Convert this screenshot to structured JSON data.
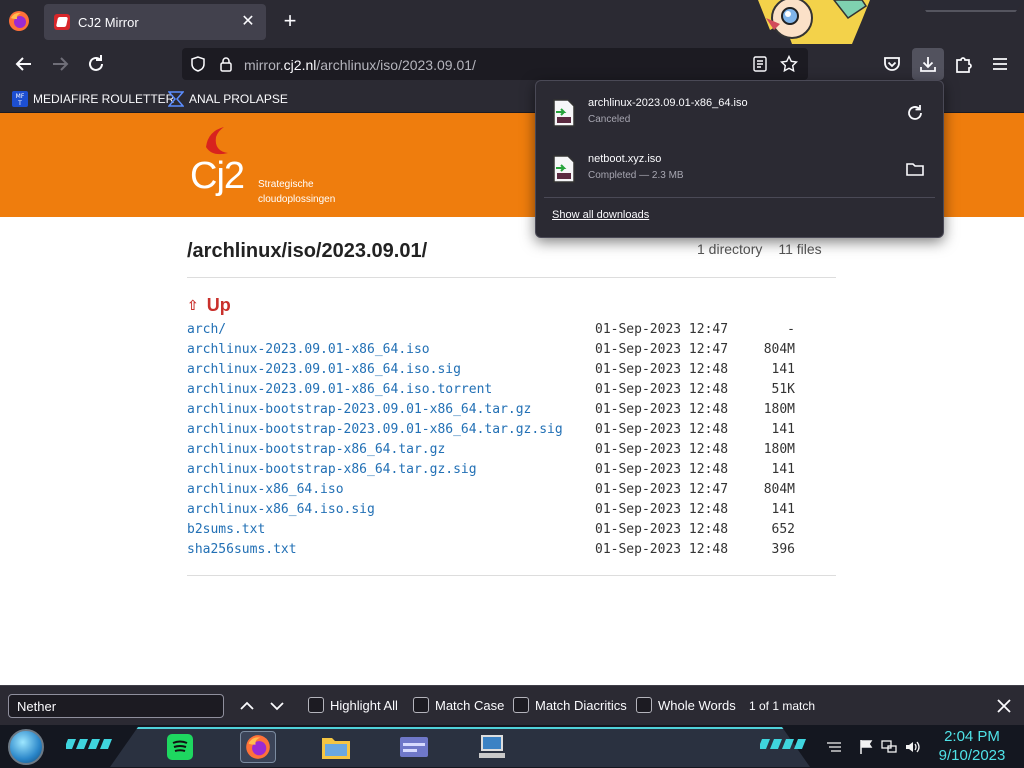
{
  "browser": {
    "tab": {
      "title": "CJ2 Mirror"
    },
    "url": {
      "prefix": "mirror.",
      "domain": "cj2.nl",
      "path": "/archlinux/iso/2023.09.01/"
    },
    "bookmarks": [
      {
        "label": "MEDIAFIRE ROULETTER",
        "icon": "mediafire-icon",
        "icon_text": "MF T"
      },
      {
        "label": "ANAL PROLAPSE",
        "icon": "bookmark-icon"
      }
    ]
  },
  "page": {
    "logo": {
      "text": "Cj2",
      "tagline_line1": "Strategische",
      "tagline_line2": "cloudoplossingen"
    },
    "title": "/archlinux/iso/2023.09.01/",
    "dir_count": "1 directory",
    "file_count": "11 files",
    "up_label": "Up",
    "files": [
      {
        "name": "arch/",
        "date": "01-Sep-2023 12:47",
        "size": "-"
      },
      {
        "name": "archlinux-2023.09.01-x86_64.iso",
        "date": "01-Sep-2023 12:47",
        "size": "804M"
      },
      {
        "name": "archlinux-2023.09.01-x86_64.iso.sig",
        "date": "01-Sep-2023 12:48",
        "size": "141"
      },
      {
        "name": "archlinux-2023.09.01-x86_64.iso.torrent",
        "date": "01-Sep-2023 12:48",
        "size": "51K"
      },
      {
        "name": "archlinux-bootstrap-2023.09.01-x86_64.tar.gz",
        "date": "01-Sep-2023 12:48",
        "size": "180M"
      },
      {
        "name": "archlinux-bootstrap-2023.09.01-x86_64.tar.gz.sig",
        "date": "01-Sep-2023 12:48",
        "size": "141"
      },
      {
        "name": "archlinux-bootstrap-x86_64.tar.gz",
        "date": "01-Sep-2023 12:48",
        "size": "180M"
      },
      {
        "name": "archlinux-bootstrap-x86_64.tar.gz.sig",
        "date": "01-Sep-2023 12:48",
        "size": "141"
      },
      {
        "name": "archlinux-x86_64.iso",
        "date": "01-Sep-2023 12:47",
        "size": "804M"
      },
      {
        "name": "archlinux-x86_64.iso.sig",
        "date": "01-Sep-2023 12:48",
        "size": "141"
      },
      {
        "name": "b2sums.txt",
        "date": "01-Sep-2023 12:48",
        "size": "652"
      },
      {
        "name": "sha256sums.txt",
        "date": "01-Sep-2023 12:48",
        "size": "396"
      }
    ]
  },
  "downloads": {
    "items": [
      {
        "name": "archlinux-2023.09.01-x86_64.iso",
        "status": "Canceled",
        "action": "retry-icon"
      },
      {
        "name": "netboot.xyz.iso",
        "status": "Completed — 2.3 MB",
        "action": "folder-icon"
      }
    ],
    "show_all": "Show all downloads"
  },
  "findbar": {
    "query": "Nether",
    "options": [
      "Highlight All",
      "Match Case",
      "Match Diacritics",
      "Whole Words"
    ],
    "match_count": "1 of 1 match"
  },
  "taskbar": {
    "time": "2:04 PM",
    "date": "9/10/2023",
    "apps": [
      "spotify-icon",
      "firefox-icon",
      "file-explorer-icon",
      "control-panel-icon",
      "computer-icon"
    ]
  },
  "colors": {
    "accent_orange": "#ef7d0d",
    "link_blue": "#2270b5",
    "up_red": "#c9302c",
    "clock_cyan": "#4fe3e8"
  }
}
